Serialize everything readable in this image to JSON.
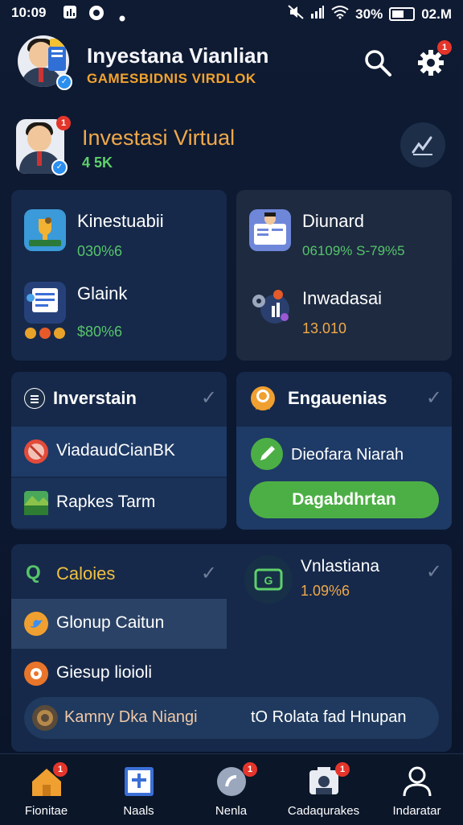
{
  "status_bar": {
    "time": "10:09",
    "battery": "30%",
    "clock_right": "02.M"
  },
  "header": {
    "title": "Inyestana Vianlian",
    "subtitle": "GAMESBIDNIS VIRDLOK"
  },
  "profile": {
    "name": "Investasi Virtual",
    "sub": "4 5K"
  },
  "stats": [
    {
      "label": "Kinestuabii",
      "value": "030%6",
      "value_color": "#56c46a"
    },
    {
      "label": "Diunard",
      "value": "06109% S-79%5",
      "value_color": "#56c46a"
    },
    {
      "label": "Glaink",
      "value": "$80%6",
      "value_color": "#56c46a"
    },
    {
      "label": "Inwadasai",
      "value": "13.010",
      "value_color": "#f0a94a"
    }
  ],
  "invest_card": {
    "title": "Inverstain",
    "items": [
      "ViadaudCianBK",
      "Rapkes Tarm"
    ]
  },
  "engage_card": {
    "title": "Engauenias",
    "item": "Dieofara Niarah",
    "button": "Dagabdhrtan"
  },
  "calories_card": {
    "title": "Caloies",
    "items": [
      "Glonup Caitun",
      "Giesup lioioli"
    ],
    "right_label": "Vnlastiana",
    "right_value": "1.09%6",
    "input_left": "Kamny Dka Niangi",
    "input_right": "tO Rolata fad Hnupan"
  },
  "notif_count": "1",
  "tabs": [
    "Fionitae",
    "Naals",
    "Nenla",
    "Cadaqurakes",
    "Indaratar"
  ]
}
